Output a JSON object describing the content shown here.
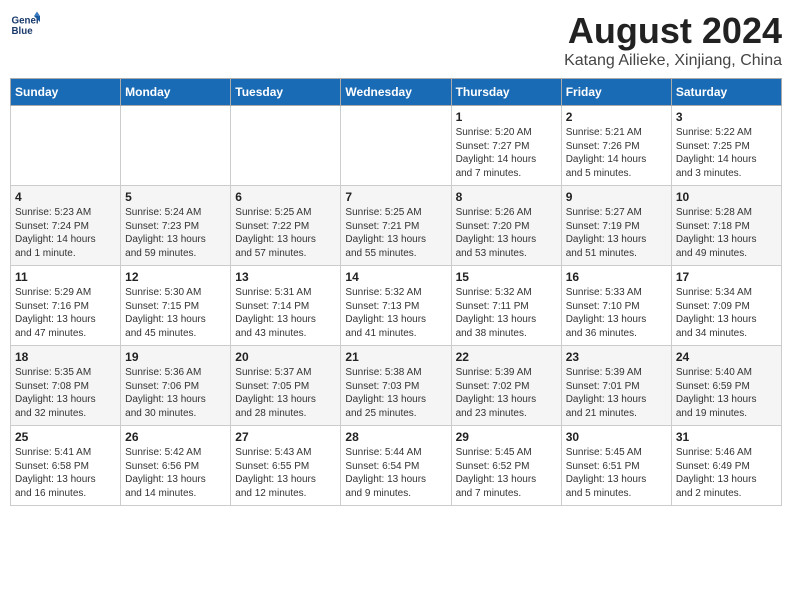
{
  "logo": {
    "line1": "General",
    "line2": "Blue"
  },
  "title": "August 2024",
  "subtitle": "Katang Ailieke, Xinjiang, China",
  "days_header": [
    "Sunday",
    "Monday",
    "Tuesday",
    "Wednesday",
    "Thursday",
    "Friday",
    "Saturday"
  ],
  "weeks": [
    [
      {
        "day": "",
        "text": ""
      },
      {
        "day": "",
        "text": ""
      },
      {
        "day": "",
        "text": ""
      },
      {
        "day": "",
        "text": ""
      },
      {
        "day": "1",
        "text": "Sunrise: 5:20 AM\nSunset: 7:27 PM\nDaylight: 14 hours\nand 7 minutes."
      },
      {
        "day": "2",
        "text": "Sunrise: 5:21 AM\nSunset: 7:26 PM\nDaylight: 14 hours\nand 5 minutes."
      },
      {
        "day": "3",
        "text": "Sunrise: 5:22 AM\nSunset: 7:25 PM\nDaylight: 14 hours\nand 3 minutes."
      }
    ],
    [
      {
        "day": "4",
        "text": "Sunrise: 5:23 AM\nSunset: 7:24 PM\nDaylight: 14 hours\nand 1 minute."
      },
      {
        "day": "5",
        "text": "Sunrise: 5:24 AM\nSunset: 7:23 PM\nDaylight: 13 hours\nand 59 minutes."
      },
      {
        "day": "6",
        "text": "Sunrise: 5:25 AM\nSunset: 7:22 PM\nDaylight: 13 hours\nand 57 minutes."
      },
      {
        "day": "7",
        "text": "Sunrise: 5:25 AM\nSunset: 7:21 PM\nDaylight: 13 hours\nand 55 minutes."
      },
      {
        "day": "8",
        "text": "Sunrise: 5:26 AM\nSunset: 7:20 PM\nDaylight: 13 hours\nand 53 minutes."
      },
      {
        "day": "9",
        "text": "Sunrise: 5:27 AM\nSunset: 7:19 PM\nDaylight: 13 hours\nand 51 minutes."
      },
      {
        "day": "10",
        "text": "Sunrise: 5:28 AM\nSunset: 7:18 PM\nDaylight: 13 hours\nand 49 minutes."
      }
    ],
    [
      {
        "day": "11",
        "text": "Sunrise: 5:29 AM\nSunset: 7:16 PM\nDaylight: 13 hours\nand 47 minutes."
      },
      {
        "day": "12",
        "text": "Sunrise: 5:30 AM\nSunset: 7:15 PM\nDaylight: 13 hours\nand 45 minutes."
      },
      {
        "day": "13",
        "text": "Sunrise: 5:31 AM\nSunset: 7:14 PM\nDaylight: 13 hours\nand 43 minutes."
      },
      {
        "day": "14",
        "text": "Sunrise: 5:32 AM\nSunset: 7:13 PM\nDaylight: 13 hours\nand 41 minutes."
      },
      {
        "day": "15",
        "text": "Sunrise: 5:32 AM\nSunset: 7:11 PM\nDaylight: 13 hours\nand 38 minutes."
      },
      {
        "day": "16",
        "text": "Sunrise: 5:33 AM\nSunset: 7:10 PM\nDaylight: 13 hours\nand 36 minutes."
      },
      {
        "day": "17",
        "text": "Sunrise: 5:34 AM\nSunset: 7:09 PM\nDaylight: 13 hours\nand 34 minutes."
      }
    ],
    [
      {
        "day": "18",
        "text": "Sunrise: 5:35 AM\nSunset: 7:08 PM\nDaylight: 13 hours\nand 32 minutes."
      },
      {
        "day": "19",
        "text": "Sunrise: 5:36 AM\nSunset: 7:06 PM\nDaylight: 13 hours\nand 30 minutes."
      },
      {
        "day": "20",
        "text": "Sunrise: 5:37 AM\nSunset: 7:05 PM\nDaylight: 13 hours\nand 28 minutes."
      },
      {
        "day": "21",
        "text": "Sunrise: 5:38 AM\nSunset: 7:03 PM\nDaylight: 13 hours\nand 25 minutes."
      },
      {
        "day": "22",
        "text": "Sunrise: 5:39 AM\nSunset: 7:02 PM\nDaylight: 13 hours\nand 23 minutes."
      },
      {
        "day": "23",
        "text": "Sunrise: 5:39 AM\nSunset: 7:01 PM\nDaylight: 13 hours\nand 21 minutes."
      },
      {
        "day": "24",
        "text": "Sunrise: 5:40 AM\nSunset: 6:59 PM\nDaylight: 13 hours\nand 19 minutes."
      }
    ],
    [
      {
        "day": "25",
        "text": "Sunrise: 5:41 AM\nSunset: 6:58 PM\nDaylight: 13 hours\nand 16 minutes."
      },
      {
        "day": "26",
        "text": "Sunrise: 5:42 AM\nSunset: 6:56 PM\nDaylight: 13 hours\nand 14 minutes."
      },
      {
        "day": "27",
        "text": "Sunrise: 5:43 AM\nSunset: 6:55 PM\nDaylight: 13 hours\nand 12 minutes."
      },
      {
        "day": "28",
        "text": "Sunrise: 5:44 AM\nSunset: 6:54 PM\nDaylight: 13 hours\nand 9 minutes."
      },
      {
        "day": "29",
        "text": "Sunrise: 5:45 AM\nSunset: 6:52 PM\nDaylight: 13 hours\nand 7 minutes."
      },
      {
        "day": "30",
        "text": "Sunrise: 5:45 AM\nSunset: 6:51 PM\nDaylight: 13 hours\nand 5 minutes."
      },
      {
        "day": "31",
        "text": "Sunrise: 5:46 AM\nSunset: 6:49 PM\nDaylight: 13 hours\nand 2 minutes."
      }
    ]
  ]
}
